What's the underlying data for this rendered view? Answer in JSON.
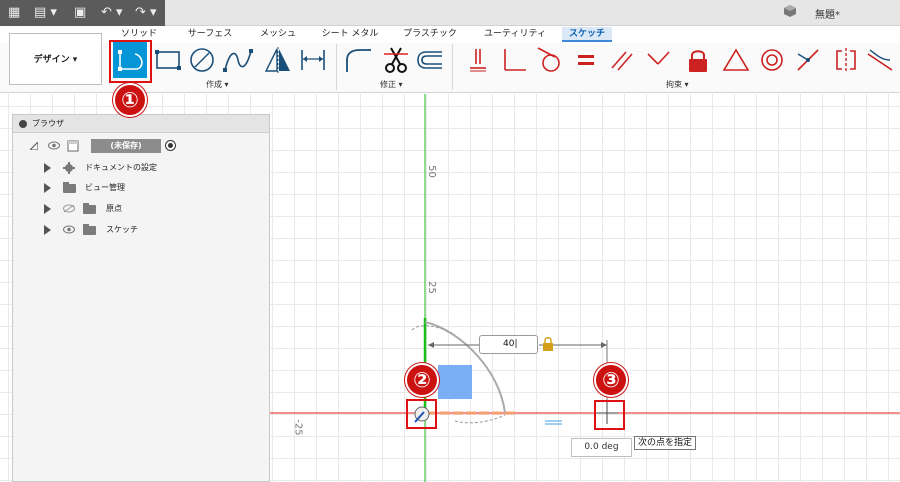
{
  "header": {
    "document_title": "無題*"
  },
  "tabs": [
    {
      "label": "ソリッド",
      "active": false
    },
    {
      "label": "サーフェス",
      "active": false
    },
    {
      "label": "メッシュ",
      "active": false
    },
    {
      "label": "シート メタル",
      "active": false
    },
    {
      "label": "プラスチック",
      "active": false
    },
    {
      "label": "ユーティリティ",
      "active": false
    },
    {
      "label": "スケッチ",
      "active": true
    }
  ],
  "toolbar": {
    "workspace_label": "デザイン ▾",
    "groups": {
      "create": "作成 ▾",
      "modify": "修正 ▾",
      "constraints": "拘束 ▾"
    },
    "tools": {
      "line": "line-icon",
      "rectangle": "rectangle-icon",
      "circle": "circle-icon",
      "spline": "spline-icon",
      "mirror": "mirror-icon",
      "dimension": "dimension-icon",
      "fillet": "fillet-icon",
      "trim": "scissors-icon",
      "offset": "offset-icon"
    }
  },
  "browser": {
    "title": "ブラウザ",
    "root_label": "(未保存)",
    "items": [
      {
        "label": "ドキュメントの設定",
        "icon": "gear-icon"
      },
      {
        "label": "ビュー管理",
        "icon": "folder-icon"
      },
      {
        "label": "原点",
        "icon": "folder-icon",
        "hidden": true
      },
      {
        "label": "スケッチ",
        "icon": "folder-icon"
      }
    ]
  },
  "canvas": {
    "axis_label_50": "50",
    "axis_label_25": "25",
    "axis_label_neg25": "-25",
    "dimension_value": "40",
    "angle_value": "0.0 deg",
    "tooltip": "次の点を指定"
  },
  "callouts": {
    "one": "①",
    "two": "②",
    "three": "③"
  },
  "colors": {
    "accent": "#0696d7",
    "axis_green": "#18c018",
    "axis_red": "#e81e1e",
    "callout_red": "#cc1111"
  }
}
